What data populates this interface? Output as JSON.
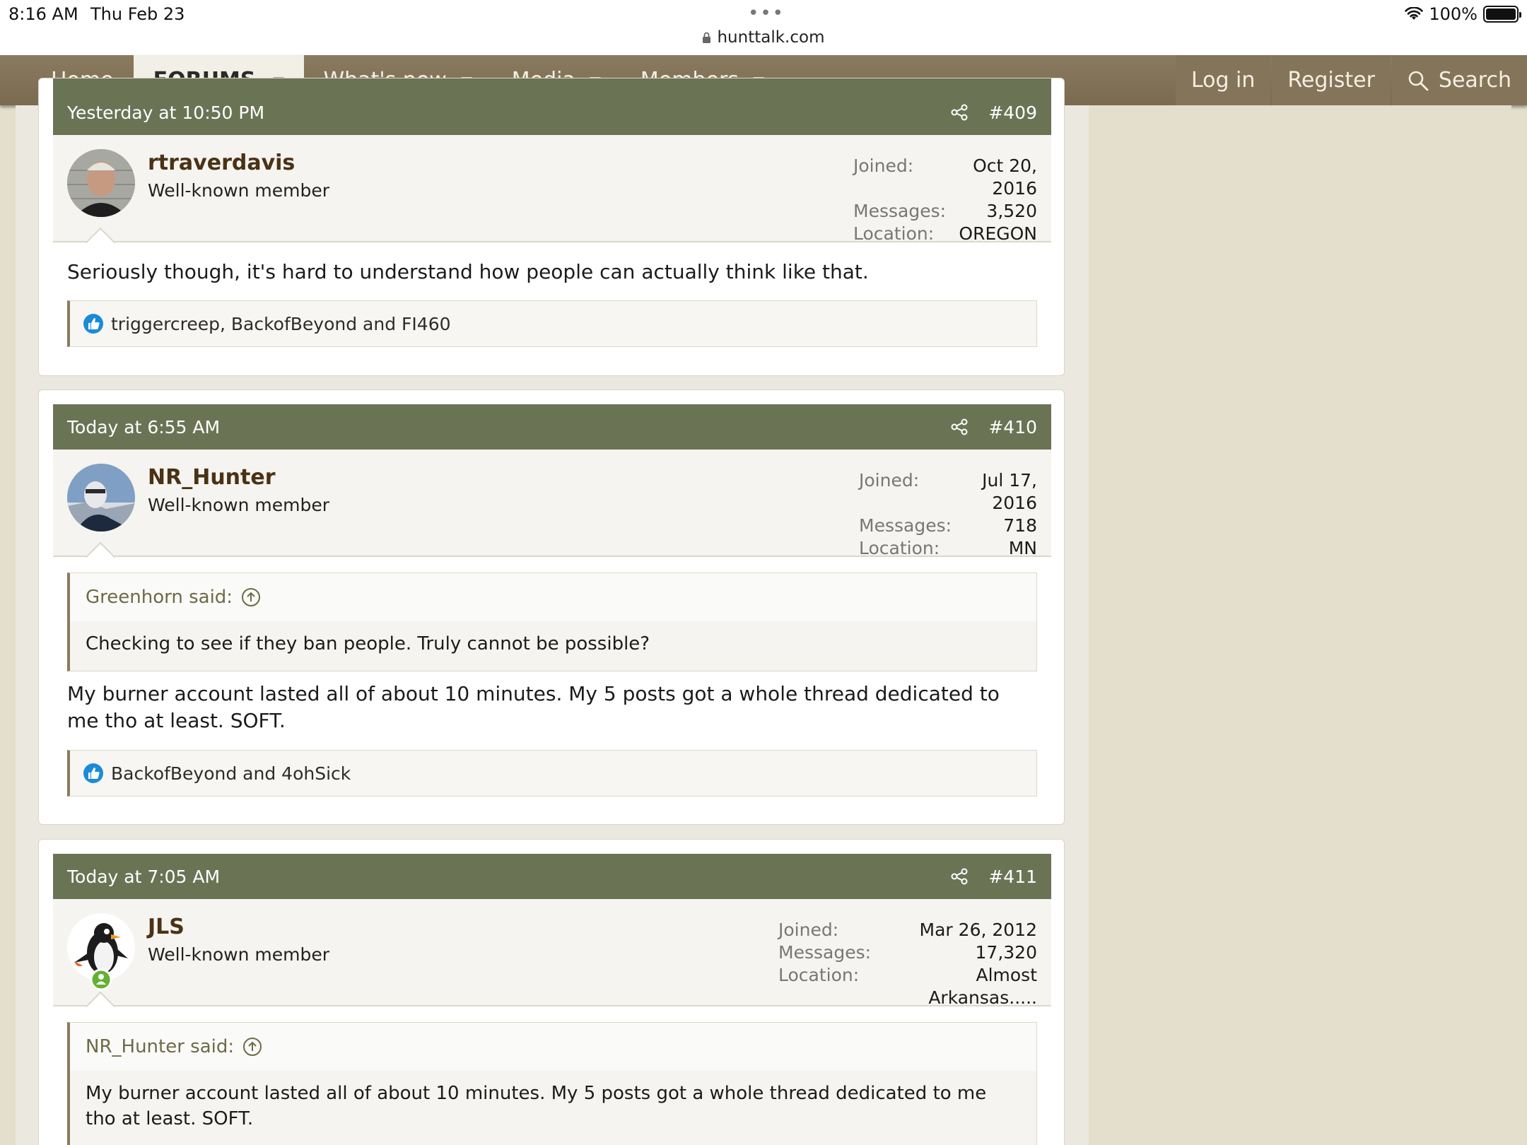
{
  "status_bar": {
    "time": "8:16 AM",
    "date": "Thu Feb 23",
    "dots": "•••",
    "url": "hunttalk.com",
    "battery": "100%"
  },
  "nav": {
    "items": [
      {
        "label": "Home"
      },
      {
        "label": "FORUMS"
      },
      {
        "label": "What's new"
      },
      {
        "label": "Media"
      },
      {
        "label": "Members"
      }
    ],
    "login": "Log in",
    "register": "Register",
    "search": "Search"
  },
  "labels": {
    "joined": "Joined:",
    "messages": "Messages:",
    "location": "Location:"
  },
  "posts": [
    {
      "time": "Yesterday at 10:50 PM",
      "number": "#409",
      "username": "rtraverdavis",
      "user_title": "Well-known member",
      "joined": "Oct 20, 2016",
      "messages": "3,520",
      "location": "OREGON",
      "body": "Seriously though, it's hard to understand how people can actually think like that.",
      "reactions": "triggercreep, BackofBeyond and FI460"
    },
    {
      "time": "Today at 6:55 AM",
      "number": "#410",
      "username": "NR_Hunter",
      "user_title": "Well-known member",
      "joined": "Jul 17, 2016",
      "messages": "718",
      "location": "MN",
      "quote_author": "Greenhorn said:",
      "quote_text": "Checking to see if they ban people. Truly cannot be possible?",
      "body": "My burner account lasted all of about 10 minutes. My 5 posts got a whole thread dedicated to me tho at least. SOFT.",
      "reactions": "BackofBeyond and 4ohSick"
    },
    {
      "time": "Today at 7:05 AM",
      "number": "#411",
      "username": "JLS",
      "user_title": "Well-known member",
      "joined": "Mar 26, 2012",
      "messages": "17,320",
      "location": "Almost Arkansas.....",
      "quote_author": "NR_Hunter said:",
      "quote_text": "My burner account lasted all of about 10 minutes. My 5 posts got a whole thread dedicated to me tho at least. SOFT."
    }
  ],
  "colors": {
    "nav_bg": "#7f6f55",
    "post_header": "#6b7355",
    "username": "#4a3215",
    "sidebar_bg": "#e3dfcc",
    "like_blue": "#1a8bd8"
  }
}
